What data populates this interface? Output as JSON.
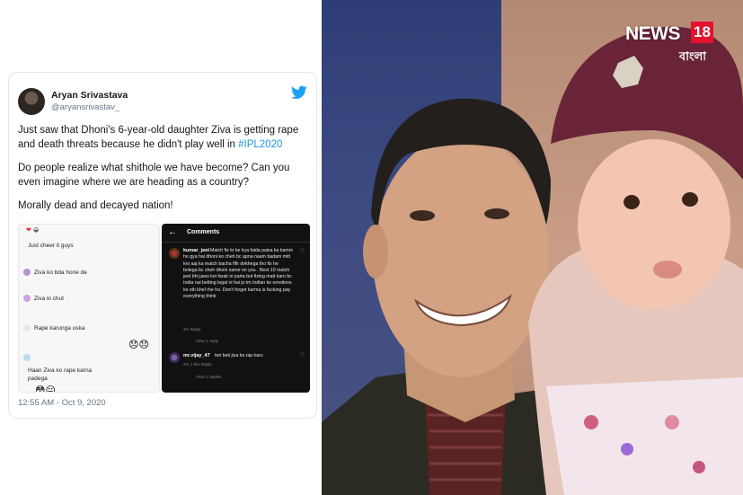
{
  "tweet": {
    "user_name": "Aryan Srivastava",
    "user_handle": "@aryansrivastav_",
    "text_line1_before": "Just saw that Dhoni's 6-year-old daughter Ziva is getting rape and death threats because he didn't play well in ",
    "hashtag": "#IPL2020",
    "text_line2": "Do people realize what shithole we have become? Can you even imagine where we are heading as a country?",
    "text_line3": "Morally dead and decayed nation!",
    "timestamp": "12:55 AM - Oct 9, 2020"
  },
  "light_comments": [
    {
      "text": "Just cheer it guys"
    },
    {
      "text": "Ziva ko bda hone de"
    },
    {
      "text": "Ziva ki chut"
    },
    {
      "text": "Rape karunga uska"
    },
    {
      "text": "Haan Ziva ko rape karna padega"
    }
  ],
  "dark_screenshot": {
    "title": "Comments",
    "comment1_user": "kumar_jeet",
    "comment1_text": "Match fix kr ke kya faida paisa ka kamni ho gya hai dhoni ko cheh bc apna naam badam mitt kro aaj ka match bacha fifir dekhega tho fix he bolega bc cheh dhoni same on you . Next 10 match jeet bhi jawo koi farak ni parta but fixing matt karo bc India nai betting legal ni hai jo tm Indian ke emotions ke sth khel rhe ho. Don't forget karma is fucking pay everything think",
    "comment1_meta": "2m   Reply",
    "comment1_replies": "View 1 reply",
    "comment2_user": "mr.vijay_47",
    "comment2_text": "teri beti jiva ka rap karu",
    "comment2_meta": "2m   1 like   Reply",
    "comment2_replies": "View 2 replies"
  },
  "watermark": {
    "brand": "NEWS",
    "number": "18",
    "sub": "বাংলা"
  },
  "colors": {
    "twitter_blue": "#1da1f2",
    "hashtag": "#1b95e0",
    "brand_red": "#e3122f"
  }
}
